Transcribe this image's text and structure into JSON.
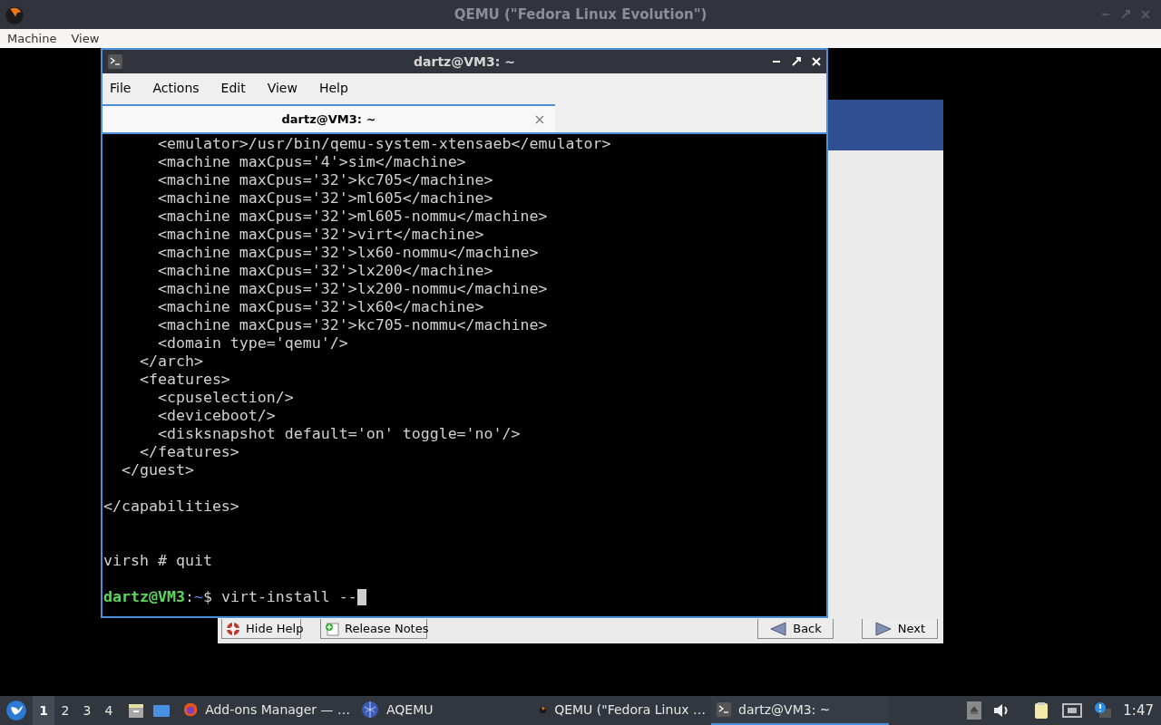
{
  "window": {
    "title": "QEMU (\"Fedora Linux Evolution\")"
  },
  "menu": [
    "Machine",
    "View"
  ],
  "installer": {
    "buttons": [
      {
        "label": "Hide Help",
        "kind": "help"
      },
      {
        "label": "Release Notes",
        "kind": "notes"
      },
      {
        "label": "Back",
        "kind": "back"
      },
      {
        "label": "Next",
        "kind": "next"
      }
    ]
  },
  "terminal": {
    "title": "dartz@VM3: ~",
    "menu": [
      "File",
      "Actions",
      "Edit",
      "View",
      "Help"
    ],
    "tabs": [
      {
        "label": "dartz@VM3: ~",
        "selected": true
      }
    ],
    "lines": [
      {
        "kind": "text",
        "text": "      <emulator>/usr/bin/qemu-system-xtensaeb</emulator>"
      },
      {
        "kind": "text",
        "text": "      <machine maxCpus='4'>sim</machine>"
      },
      {
        "kind": "text",
        "text": "      <machine maxCpus='32'>kc705</machine>"
      },
      {
        "kind": "text",
        "text": "      <machine maxCpus='32'>ml605</machine>"
      },
      {
        "kind": "text",
        "text": "      <machine maxCpus='32'>ml605-nommu</machine>"
      },
      {
        "kind": "text",
        "text": "      <machine maxCpus='32'>virt</machine>"
      },
      {
        "kind": "text",
        "text": "      <machine maxCpus='32'>lx60-nommu</machine>"
      },
      {
        "kind": "text",
        "text": "      <machine maxCpus='32'>lx200</machine>"
      },
      {
        "kind": "text",
        "text": "      <machine maxCpus='32'>lx200-nommu</machine>"
      },
      {
        "kind": "text",
        "text": "      <machine maxCpus='32'>lx60</machine>"
      },
      {
        "kind": "text",
        "text": "      <machine maxCpus='32'>kc705-nommu</machine>"
      },
      {
        "kind": "text",
        "text": "      <domain type='qemu'/>"
      },
      {
        "kind": "text",
        "text": "    </arch>"
      },
      {
        "kind": "text",
        "text": "    <features>"
      },
      {
        "kind": "text",
        "text": "      <cpuselection/>"
      },
      {
        "kind": "text",
        "text": "      <deviceboot/>"
      },
      {
        "kind": "text",
        "text": "      <disksnapshot default='on' toggle='no'/>"
      },
      {
        "kind": "text",
        "text": "    </features>"
      },
      {
        "kind": "text",
        "text": "  </guest>"
      },
      {
        "kind": "blank"
      },
      {
        "kind": "text",
        "text": "</capabilities>"
      },
      {
        "kind": "blank"
      },
      {
        "kind": "blank"
      },
      {
        "kind": "text",
        "text": "virsh # quit"
      },
      {
        "kind": "blank"
      },
      {
        "kind": "prompt",
        "user_host": "dartz@VM3",
        "separator": ":",
        "path": "~",
        "symbol": "$",
        "command": "virt-install --"
      }
    ]
  },
  "taskbar": {
    "workspaces": [
      {
        "label": "1",
        "selected": true
      },
      {
        "label": "2",
        "selected": false
      },
      {
        "label": "3",
        "selected": false
      },
      {
        "label": "4",
        "selected": false
      }
    ],
    "tasks": [
      {
        "label": "Add-ons Manager — …",
        "kind": "firefox",
        "selected": false
      },
      {
        "label": "AQEMU",
        "kind": "aqemu",
        "selected": false
      },
      {
        "label": "QEMU (\"Fedora Linux …",
        "kind": "qemu",
        "selected": false
      },
      {
        "label": "dartz@VM3: ~",
        "kind": "terminal",
        "selected": true
      }
    ],
    "clock": "1:47"
  }
}
